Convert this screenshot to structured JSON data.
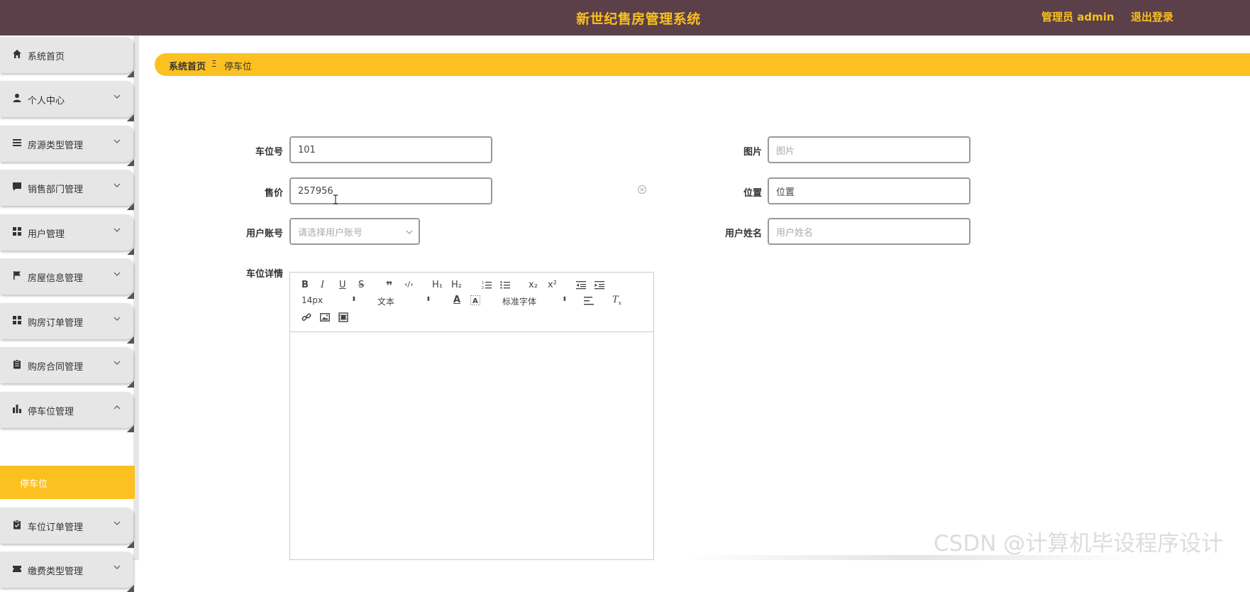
{
  "header": {
    "title": "新世纪售房管理系统",
    "user_label": "管理员 admin",
    "logout_label": "退出登录"
  },
  "sidebar": {
    "items": [
      {
        "label": "系统首页",
        "icon": "home-icon",
        "has_arrow": false
      },
      {
        "label": "个人中心",
        "icon": "person-icon",
        "has_arrow": true
      },
      {
        "label": "房源类型管理",
        "icon": "list-icon",
        "has_arrow": true
      },
      {
        "label": "销售部门管理",
        "icon": "chat-icon",
        "has_arrow": true
      },
      {
        "label": "用户管理",
        "icon": "grid-icon",
        "has_arrow": true
      },
      {
        "label": "房屋信息管理",
        "icon": "flag-icon",
        "has_arrow": true
      },
      {
        "label": "购房订单管理",
        "icon": "grid-icon",
        "has_arrow": true
      },
      {
        "label": "购房合同管理",
        "icon": "clipboard-icon",
        "has_arrow": true
      },
      {
        "label": "停车位管理",
        "icon": "bar-chart-icon",
        "has_arrow": true,
        "expanded": true
      },
      {
        "label": "车位订单管理",
        "icon": "clipboard-check-icon",
        "has_arrow": true
      },
      {
        "label": "缴费类型管理",
        "icon": "ticket-icon",
        "has_arrow": true
      }
    ],
    "submenu": {
      "label": "停车位"
    }
  },
  "breadcrumb": {
    "home": "系统首页",
    "separator": "Ξ",
    "current": "停车位"
  },
  "form": {
    "parking_no": {
      "label": "车位号",
      "value": "101"
    },
    "price": {
      "label": "售价",
      "value": "257956"
    },
    "user_account": {
      "label": "用户账号",
      "placeholder": "请选择用户账号"
    },
    "image": {
      "label": "图片",
      "placeholder": "图片"
    },
    "location": {
      "label": "位置",
      "value": "位置"
    },
    "user_name": {
      "label": "用户姓名",
      "placeholder": "用户姓名"
    },
    "details": {
      "label": "车位详情"
    }
  },
  "editor": {
    "toolbar": {
      "bold": "B",
      "italic": "I",
      "underline": "U",
      "strike": "S",
      "blockquote": "❞",
      "code": "‹/›",
      "h1": "H₁",
      "h2": "H₂",
      "subscript": "x₂",
      "superscript": "x²",
      "size_select": "14px",
      "header_select": "文本",
      "font_select": "标准字体"
    }
  },
  "watermark": "CSDN @计算机毕设程序设计",
  "colors": {
    "header_bg": "#5b3f49",
    "accent": "#fcc121",
    "header_text": "#f9c01e"
  }
}
